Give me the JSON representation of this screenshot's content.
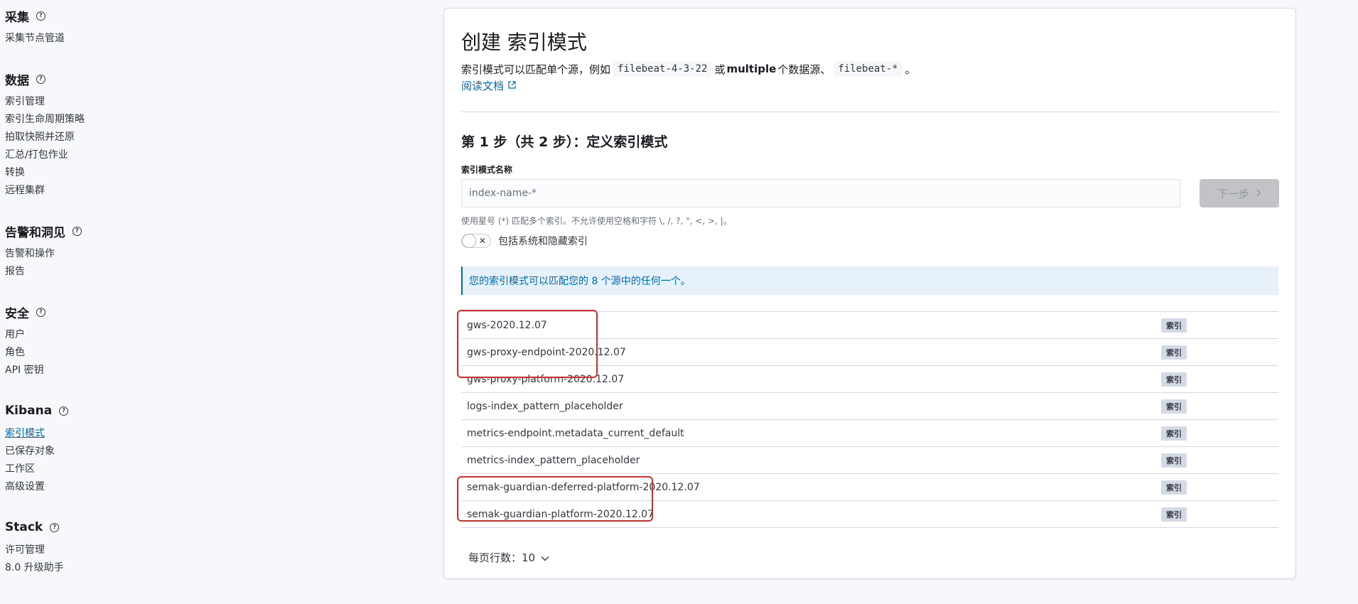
{
  "sidebar": {
    "sections": [
      {
        "title": "采集",
        "items": [
          "采集节点管道"
        ]
      },
      {
        "title": "数据",
        "items": [
          "索引管理",
          "索引生命周期策略",
          "拍取快照并还原",
          "汇总/打包作业",
          "转换",
          "远程集群"
        ]
      },
      {
        "title": "告警和洞见",
        "items": [
          "告警和操作",
          "报告"
        ]
      },
      {
        "title": "安全",
        "items": [
          "用户",
          "角色",
          "API 密钥"
        ]
      },
      {
        "title": "Kibana",
        "items": [
          "索引模式",
          "已保存对象",
          "工作区",
          "高级设置"
        ]
      },
      {
        "title": "Stack",
        "items": [
          "许可管理",
          "8.0 升级助手"
        ]
      }
    ],
    "active_item": "索引模式"
  },
  "panel": {
    "title": "创建 索引模式",
    "desc_prefix": "索引模式可以匹配单个源，例如",
    "desc_code1": "filebeat-4-3-22",
    "desc_or": "或",
    "desc_bold": "multiple",
    "desc_middle": "个数据源、",
    "desc_code2": "filebeat-*",
    "desc_end": "。",
    "doc_link": "阅读文档",
    "step_title": "第 1 步（共 2 步）：定义索引模式",
    "field_label": "索引模式名称",
    "input_placeholder": "index-name-*",
    "next_button": "下一步",
    "help_text": "使用星号 (*) 匹配多个索引。不允许使用空格和字符 \\, /, ?, \", <, >, |。",
    "toggle_label": "包括系统和隐藏索引",
    "callout": "您的索引模式可以匹配您的 8 个源中的任何一个。",
    "badge_label": "索引",
    "rows": [
      "gws-2020.12.07",
      "gws-proxy-endpoint-2020.12.07",
      "gws-proxy-platform-2020.12.07",
      "logs-index_pattern_placeholder",
      "metrics-endpoint.metadata_current_default",
      "metrics-index_pattern_placeholder",
      "semak-guardian-deferred-platform-2020.12.07",
      "semak-guardian-platform-2020.12.07"
    ],
    "pager_label": "每页行数：10"
  },
  "colors": {
    "accent": "#006bb4",
    "highlight": "#e0292b"
  }
}
